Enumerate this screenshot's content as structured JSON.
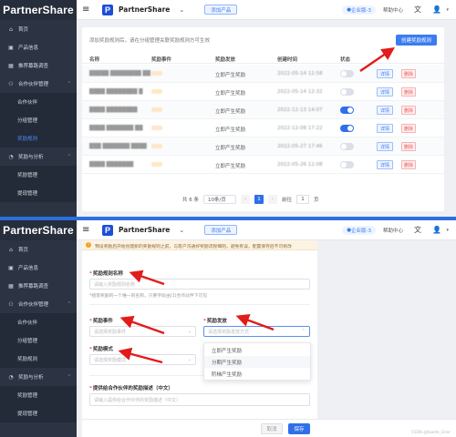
{
  "app": {
    "brand": "PartnerShare",
    "product_name": "PartnerShare",
    "add_product_label": "添加产品",
    "edition_badge": "企业版-3",
    "help_label": "帮助中心",
    "lang_icon": "translate-icon",
    "user_icon": "user-icon"
  },
  "sidebar_top": {
    "items": [
      {
        "label": "首页",
        "icon": "home-icon"
      },
      {
        "label": "产品信息",
        "icon": "box-icon"
      },
      {
        "label": "推荐募路调查",
        "icon": "grid-icon"
      },
      {
        "label": "合作伙伴管理",
        "icon": "partner-icon"
      },
      {
        "label": "合作伙伴",
        "sub": true
      },
      {
        "label": "分组管理",
        "sub": true
      },
      {
        "label": "奖励规则",
        "sub": true,
        "active": true
      },
      {
        "label": "奖励与分析",
        "icon": "analytics-icon"
      },
      {
        "label": "奖励管理",
        "sub": true
      },
      {
        "label": "提现管理",
        "sub": true
      }
    ]
  },
  "sidebar_bottom": {
    "items": [
      {
        "label": "首页",
        "icon": "home-icon"
      },
      {
        "label": "产品信息",
        "icon": "box-icon"
      },
      {
        "label": "推荐募路调查",
        "icon": "grid-icon"
      },
      {
        "label": "合作伙伴管理",
        "icon": "partner-icon"
      },
      {
        "label": "合作伙伴",
        "sub": true
      },
      {
        "label": "分组管理",
        "sub": true
      },
      {
        "label": "奖励规则",
        "sub": true
      },
      {
        "label": "奖励与分析",
        "icon": "analytics-icon"
      },
      {
        "label": "奖励管理",
        "sub": true
      },
      {
        "label": "提现管理",
        "sub": true
      }
    ]
  },
  "rules_page": {
    "hint": "添加奖励规则后，请在分组管理关联奖励规则方可生效",
    "create_button": "创建奖励规则",
    "columns": [
      "名称",
      "奖励事件",
      "奖励发放",
      "创建时间",
      "状态"
    ],
    "rows": [
      {
        "name": "█████ ████████ ██",
        "release": "立即产生奖励",
        "created": "2022-05-14 12:58",
        "status_on": false
      },
      {
        "name": "████ ████████ █",
        "release": "立即产生奖励",
        "created": "2022-05-14 12:32",
        "status_on": false
      },
      {
        "name": "████ ████████",
        "release": "立即产生奖励",
        "created": "2022-12-13 14:07",
        "status_on": true
      },
      {
        "name": "████ ███████ ██",
        "release": "立即产生奖励",
        "created": "2022-12-08 17:22",
        "status_on": true
      },
      {
        "name": "███ ███████ ████",
        "release": "立即产生奖励",
        "created": "2022-05-27 17:46",
        "status_on": false
      },
      {
        "name": "████ ███████",
        "release": "立即产生奖励",
        "created": "2022-05-26 12:08",
        "status_on": false
      }
    ],
    "detail_label": "详情",
    "delete_label": "删除",
    "pager": {
      "total": "共 6 条",
      "per_page": "10条/页",
      "current": "1",
      "goto_prefix": "前往",
      "goto_value": "1",
      "goto_suffix": "页"
    }
  },
  "form_page": {
    "alert": "预设奖励后开始创建新的奖励规则之前，与客户沟通好奖励流程细则，避免有误，配置保存后不可修改",
    "rule_name_label": "奖励规则名称",
    "rule_name_placeholder": "请输入奖励规则名称",
    "rule_name_help": "*组客奖励的一个唯一的名称，只要字段由(1)合作伙伴下可见",
    "event_label": "奖励事件",
    "event_placeholder": "请选择奖励事件",
    "release_label": "奖励发放",
    "release_placeholder": "请选择奖励发放方式",
    "mode_label": "奖励模式",
    "mode_placeholder": "请选择奖励模式",
    "release_options": [
      "立即产生奖励",
      "分期产生奖励",
      "阶梯产生奖励"
    ],
    "desc_label": "提供给合作伙伴的奖励描述（中文）",
    "desc_placeholder": "请输入提供给合作伙伴的奖励描述（中文）",
    "cancel_label": "取消",
    "save_label": "保存",
    "watermark": "CSDN @Kaede_Grier"
  },
  "colors": {
    "sidebar": "#2c3444",
    "primary": "#2f6fe8",
    "annotation_arrow": "#e21b1b"
  }
}
